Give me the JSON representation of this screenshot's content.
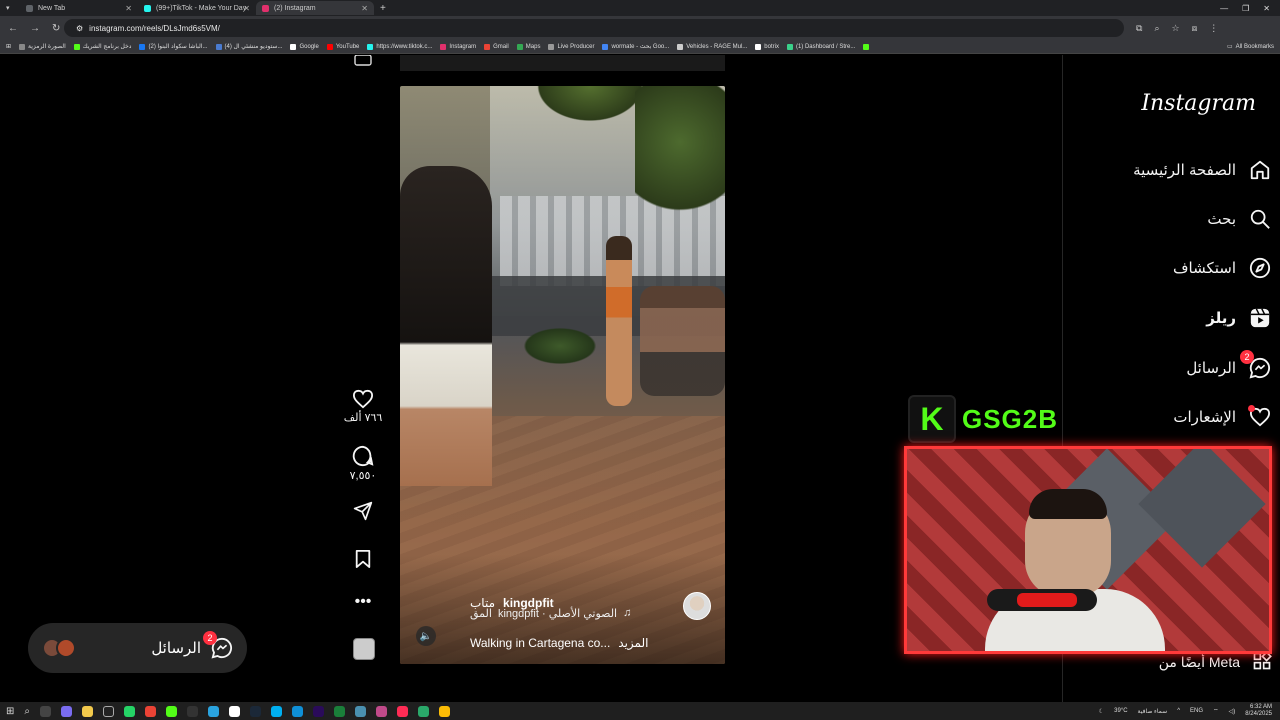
{
  "browser": {
    "tabs": [
      {
        "title": "New Tab",
        "active": false,
        "color": "#5f6368"
      },
      {
        "title": "(99+)TikTok - Make Your Day",
        "active": false,
        "color": "#25f4ee"
      },
      {
        "title": "(2) Instagram",
        "active": true,
        "color": "#e1306c"
      }
    ],
    "url": "instagram.com/reels/DLsJmd6s5VM/",
    "bookmarks": [
      "الصورة الرمزية",
      "دخل برنامج الشريك",
      "(2) الباشا سكواد البنوا...",
      "(4) ستوديو منشئي ال...",
      "Google",
      "YouTube",
      "https://www.tiktok.c...",
      "Instagram",
      "Gmail",
      "Maps",
      "Live Producer",
      "wormate - بحث Goo...",
      "Vehicles - RAGE Mul...",
      "botrix",
      "(1) Dashboard / Stre..."
    ],
    "all_bookmarks": "All Bookmarks"
  },
  "instagram": {
    "logo": "Instagram",
    "nav": [
      {
        "label": "الصفحة الرئيسية",
        "icon": "home-icon"
      },
      {
        "label": "بحث",
        "icon": "search-icon"
      },
      {
        "label": "استكشاف",
        "icon": "compass-icon"
      },
      {
        "label": "ريلز",
        "icon": "reels-icon"
      },
      {
        "label": "الرسائل",
        "icon": "messenger-icon",
        "badge": "2"
      },
      {
        "label": "الإشعارات",
        "icon": "heart-icon"
      }
    ],
    "more_from_meta": "أيضًا من Meta"
  },
  "reel": {
    "author": "kingdpfit",
    "follow": "متاب",
    "audio": "kingdpfit · الصوتي الأصلي",
    "audio_prefix": "المق",
    "caption": "Walking in Cartagena co...",
    "more": "المزيد",
    "likes": "٧٦٦ ألف",
    "comments": "٧,٥٥٠"
  },
  "messages_pill": {
    "label": "الرسائل",
    "badge": "2"
  },
  "stream": {
    "channel": "GSG2B",
    "brand_color": "#53fc18"
  },
  "taskbar": {
    "weather": "39°C",
    "weather_text": "سماء صافية",
    "lang": "ENG",
    "time": "6:32 AM",
    "date": "8/24/2025"
  }
}
